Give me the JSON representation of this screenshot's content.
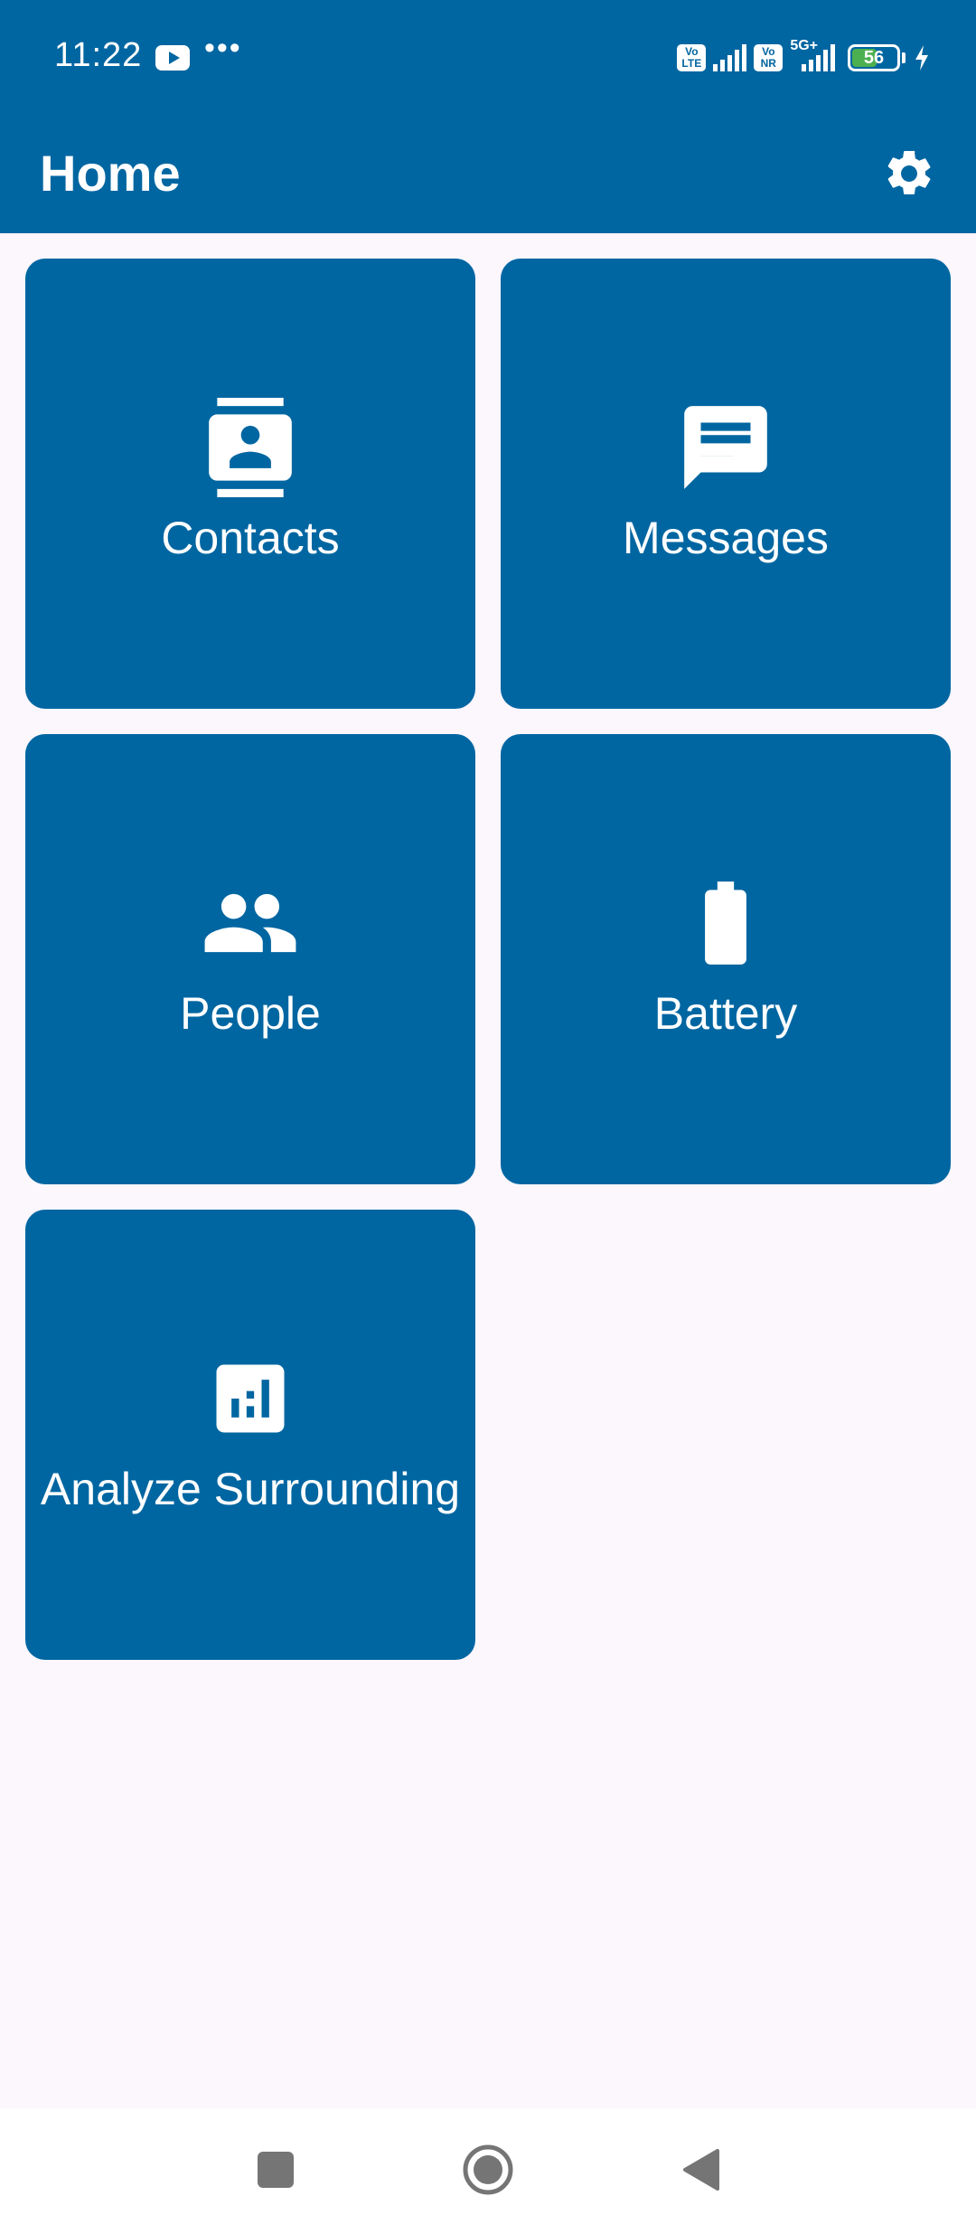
{
  "status_bar": {
    "time": "11:22",
    "more": "•••",
    "volte_1": "Vo LTE",
    "volte_2": "Vo NR",
    "network": "5G+",
    "battery_level": "56",
    "battery_fraction": 0.56,
    "icons": [
      "youtube-icon",
      "more-dots-icon",
      "volte-icon",
      "signal-icon",
      "vonr-icon",
      "signal-5g-icon",
      "battery-icon",
      "charging-icon"
    ]
  },
  "app_bar": {
    "title": "Home",
    "settings_icon": "gear-icon"
  },
  "tiles": [
    {
      "label": "Contacts",
      "icon": "contacts-icon"
    },
    {
      "label": "Messages",
      "icon": "message-icon"
    },
    {
      "label": "People",
      "icon": "people-icon"
    },
    {
      "label": "Battery",
      "icon": "battery-icon"
    },
    {
      "label": "Analyze Surrounding",
      "icon": "analytics-icon"
    }
  ],
  "nav_bar": {
    "icons": [
      "recents-icon",
      "home-icon",
      "back-icon"
    ]
  },
  "colors": {
    "primary": "#0066A1",
    "background": "#FCF6FD",
    "on_primary": "#FFFFFF",
    "nav_icon": "#757575",
    "battery_fill": "#4CAF50"
  }
}
